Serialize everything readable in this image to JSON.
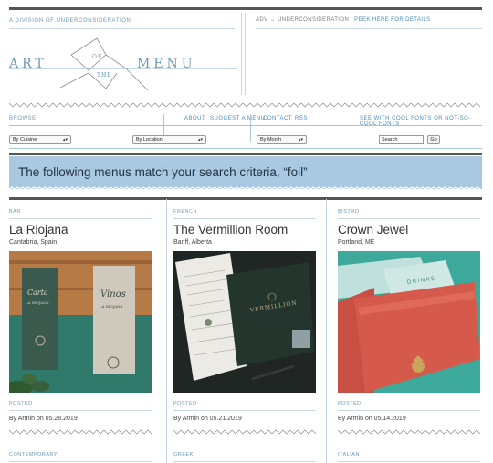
{
  "header": {
    "division": "A DIVISION OF UNDERCONSIDERATION",
    "logo": {
      "left": "ART",
      "of": "OF",
      "the": "THE",
      "right": "MENU"
    },
    "adv": "ADV → UNDERCONSIDERATION",
    "peek": "PEEK HERE FOR DETAILS"
  },
  "nav": {
    "browse": "BROWSE",
    "links": [
      "ABOUT",
      "SUGGEST A MENU",
      "CONTACT",
      "RSS"
    ],
    "see_with": "SEE WITH COOL FONTS OR NOT-SO-COOL FONTS"
  },
  "filters": {
    "cuisine": "By Cuisine",
    "location": "By Location",
    "month": "By Month",
    "search_value": "Search",
    "go": "Go"
  },
  "banner": {
    "text": "The following menus match your search criteria, “foil”"
  },
  "posts": [
    {
      "category": "BAR",
      "title": "La Riojana",
      "location": "Cantabria, Spain",
      "posted_label": "POSTED",
      "byline": "By Armin on 05.28.2019",
      "next_category": "CONTEMPORARY"
    },
    {
      "category": "FRENCH",
      "title": "The Vermillion Room",
      "location": "Banff, Alberta",
      "posted_label": "POSTED",
      "byline": "By Armin on 05.21.2019",
      "next_category": "GREEK"
    },
    {
      "category": "BISTRO",
      "title": "Crown Jewel",
      "location": "Portland, ME",
      "posted_label": "POSTED",
      "byline": "By Armin on 05.14.2019",
      "next_category": "ITALIAN"
    }
  ],
  "photo_text": {
    "riojana_left": "Carta",
    "riojana_brand": "LA RIOJANA",
    "riojana_right": "Vinos",
    "vermillion": "VERMILLION",
    "crown_drinks": "DRINKS"
  },
  "colors": {
    "accent": "#4a8db7",
    "banner": "#a9c8e2",
    "dark_rule": "#555555"
  }
}
